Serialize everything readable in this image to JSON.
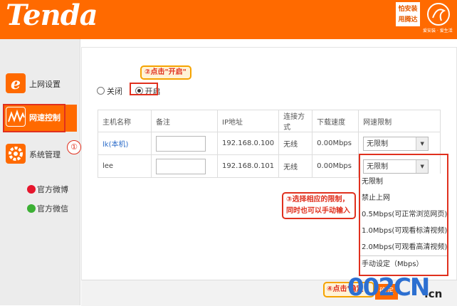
{
  "header": {
    "logo": "Tenda",
    "ad_line1": "怕安装",
    "ad_line2": "用腾达",
    "ad_sub": "爱安装 · 爱生活"
  },
  "sidebar": {
    "items": [
      {
        "label": "上网设置",
        "icon": "internet-e-icon"
      },
      {
        "label": "网速控制",
        "icon": "speed-wave-icon"
      },
      {
        "label": "系统管理",
        "icon": "gear-icon"
      }
    ],
    "weibo": "官方微博",
    "weixin": "官方微信"
  },
  "control": {
    "off_label": "关闭",
    "on_label": "开启",
    "selected": "on"
  },
  "table": {
    "headers": [
      "主机名称",
      "备注",
      "IP地址",
      "连接方式",
      "下载速度",
      "网速限制"
    ],
    "rows": [
      {
        "host": "lk(本机)",
        "note": "",
        "ip": "192.168.0.100",
        "conn": "无线",
        "speed": "0.00Mbps",
        "limit": "无限制"
      },
      {
        "host": "lee",
        "note": "",
        "ip": "192.168.0.101",
        "conn": "无线",
        "speed": "0.00Mbps",
        "limit": "无限制"
      }
    ]
  },
  "dropdown": {
    "options": [
      "无限制",
      "禁止上网",
      "0.5Mbps(可正常浏览网页)",
      "1.0Mbps(可观看标清视频)",
      "2.0Mbps(可观看高清视频)",
      "手动设定（Mbps）"
    ]
  },
  "annotations": {
    "step1": "①",
    "step2": "②点击\"开启\"",
    "step3_line1": "③选择相应的限制，",
    "step3_line2": "同时也可以手动输入",
    "step4": "④点击'确定'"
  },
  "footer": {
    "save_label": "确定"
  },
  "watermark": {
    "main": "002CN",
    "suffix": ".cn"
  },
  "colors": {
    "brand": "#ff6a00",
    "highlight": "#e0301e",
    "link": "#2a6bc9"
  }
}
